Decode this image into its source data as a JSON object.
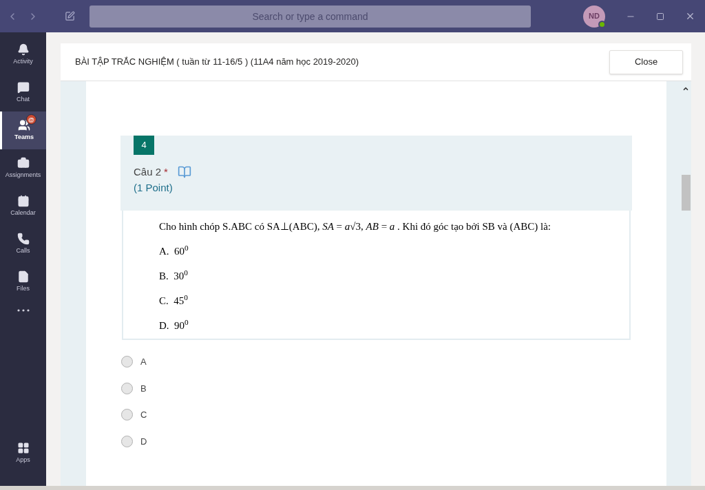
{
  "window": {
    "search": {
      "placeholder": "Search or type a command"
    },
    "avatar": {
      "initials": "ND",
      "online": true
    }
  },
  "sidebar": {
    "items": [
      {
        "label": "Activity",
        "selected": false
      },
      {
        "label": "Chat",
        "selected": false
      },
      {
        "label": "Teams",
        "selected": true,
        "badge": "@"
      },
      {
        "label": "Assignments",
        "selected": false
      },
      {
        "label": "Calendar",
        "selected": false
      },
      {
        "label": "Calls",
        "selected": false
      },
      {
        "label": "Files",
        "selected": false
      }
    ],
    "bottom_items": [
      {
        "label": "Apps",
        "selected": false
      }
    ]
  },
  "panel": {
    "title": "BÀI TẬP TRẮC NGHIỆM ( tuần từ 11-16/5 ) (11A4 năm học 2019-2020)",
    "close_button": "Close"
  },
  "question": {
    "number": "4",
    "title": "Câu 2",
    "required": true,
    "required_mark": "*",
    "points": "(1 Point)",
    "content": {
      "text": "Cho hình chóp S.ABC có SA⊥(ABC),  *SA* = *a*√3,  *AB* = *a* . Khi đó góc tạo bởi SB và (ABC) là:",
      "options": [
        "A.  60$^{0}$",
        "B.  30$^{0}$",
        "C.  45$^{0}$",
        "D.  90$^{0}$"
      ]
    },
    "choices": [
      {
        "label": "A",
        "selected": false
      },
      {
        "label": "B",
        "selected": false
      },
      {
        "label": "C",
        "selected": false
      },
      {
        "label": "D",
        "selected": false
      }
    ]
  }
}
